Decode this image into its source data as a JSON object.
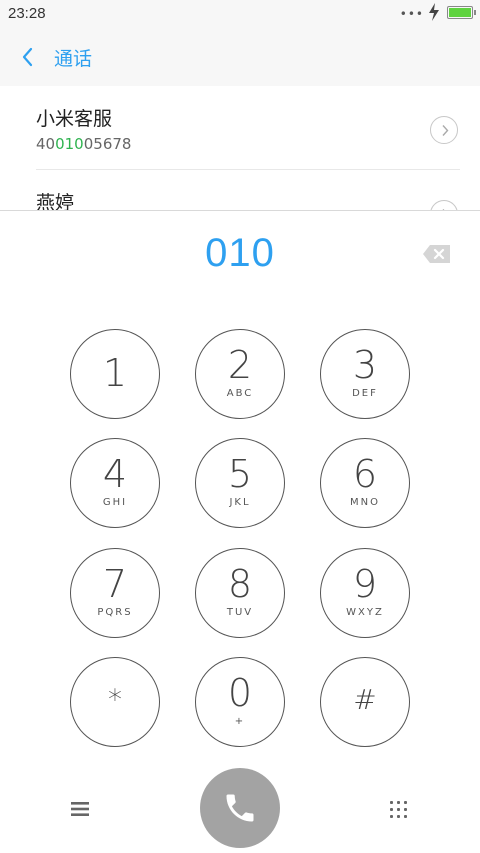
{
  "status_bar": {
    "time": "23:28",
    "dots": "•••",
    "battery_level": 1.0
  },
  "header": {
    "title": "通话"
  },
  "results": [
    {
      "name": "小米客服",
      "number_prefix": "40",
      "number_match": "010",
      "number_suffix": "05678"
    },
    {
      "name": "燕婷"
    }
  ],
  "dial": {
    "input": "010"
  },
  "keys": [
    {
      "digit": "1",
      "letters": ""
    },
    {
      "digit": "2",
      "letters": "ABC"
    },
    {
      "digit": "3",
      "letters": "DEF"
    },
    {
      "digit": "4",
      "letters": "GHI"
    },
    {
      "digit": "5",
      "letters": "JKL"
    },
    {
      "digit": "6",
      "letters": "MNO"
    },
    {
      "digit": "7",
      "letters": "PQRS"
    },
    {
      "digit": "8",
      "letters": "TUV"
    },
    {
      "digit": "9",
      "letters": "WXYZ"
    },
    {
      "digit": "*",
      "letters": ""
    },
    {
      "digit": "0",
      "letters": "+"
    },
    {
      "digit": "#",
      "letters": ""
    }
  ],
  "colors": {
    "accent": "#2ea0f0",
    "match": "#2fb350",
    "call": "#a3a3a3",
    "battery": "#5fd33f"
  },
  "icons": {
    "back": "chevron-left-icon",
    "backspace": "backspace-icon",
    "menu": "menu-icon",
    "call": "phone-icon",
    "keypad": "keypad-icon",
    "detail": "chevron-right-icon"
  }
}
